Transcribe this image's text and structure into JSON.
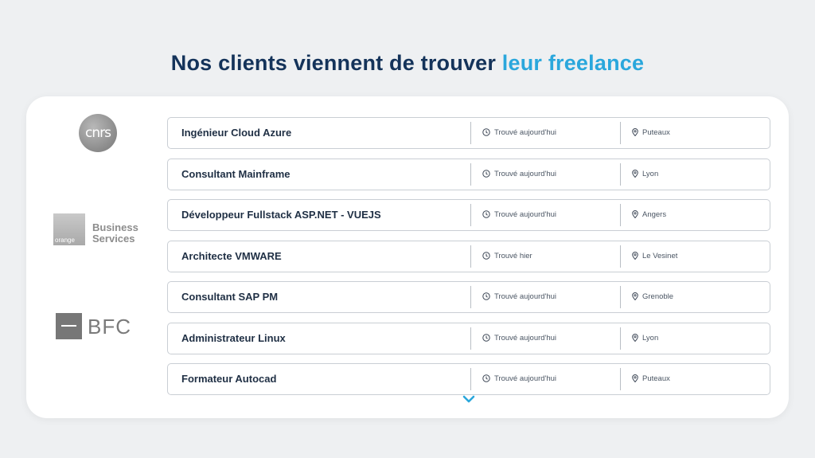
{
  "header": {
    "title_main": "Nos clients viennent de trouver",
    "title_accent": "leur freelance",
    "accent_color": "#2aa7dc",
    "title_color": "#14335a"
  },
  "logos": {
    "cnrs": "cnrs",
    "orange_tag": "orange",
    "orange_line1": "Business",
    "orange_line2": "Services",
    "bfc": "BFC"
  },
  "jobs": [
    {
      "title": "Ingénieur Cloud Azure",
      "found": "Trouvé aujourd'hui",
      "location": "Puteaux"
    },
    {
      "title": "Consultant Mainframe",
      "found": "Trouvé aujourd'hui",
      "location": "Lyon"
    },
    {
      "title": "Développeur Fullstack ASP.NET - VUEJS",
      "found": "Trouvé aujourd'hui",
      "location": "Angers"
    },
    {
      "title": "Architecte VMWARE",
      "found": "Trouvé hier",
      "location": "Le Vesinet"
    },
    {
      "title": "Consultant SAP PM",
      "found": "Trouvé aujourd'hui",
      "location": "Grenoble"
    },
    {
      "title": "Administrateur Linux",
      "found": "Trouvé aujourd'hui",
      "location": "Lyon"
    },
    {
      "title": "Formateur Autocad",
      "found": "Trouvé aujourd'hui",
      "location": "Puteaux"
    }
  ],
  "icons": {
    "time": "clock-icon",
    "location": "map-pin-icon",
    "more": "chevron-down-icon"
  }
}
